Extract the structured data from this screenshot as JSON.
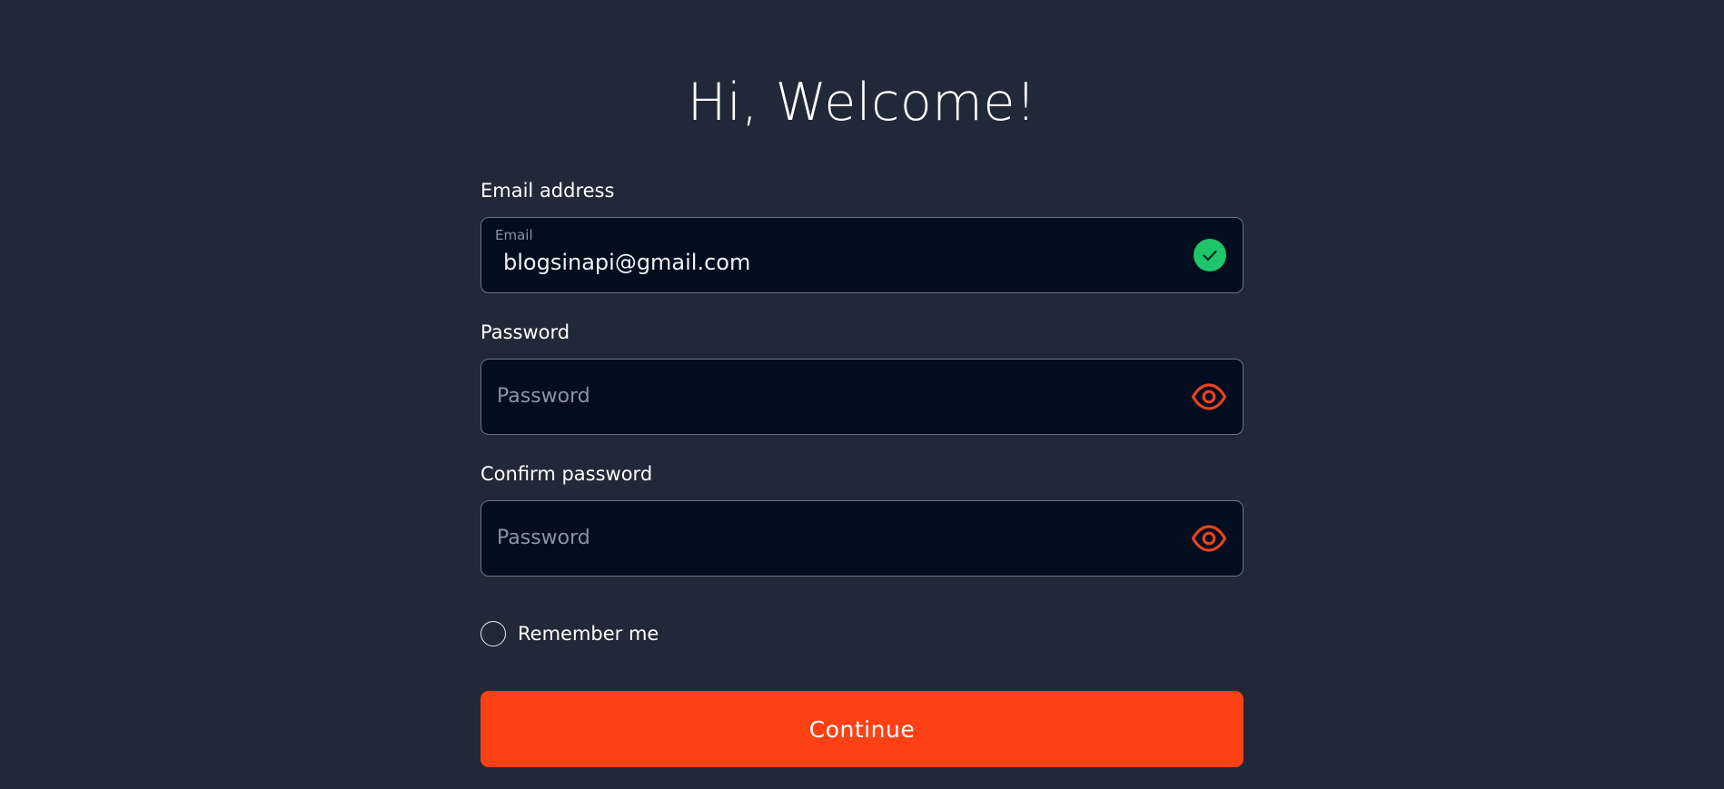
{
  "header": {
    "title": "Hi, Welcome!"
  },
  "form": {
    "email": {
      "label": "Email address",
      "floating_label": "Email",
      "value": "blogsinapi@gmail.com",
      "status_icon": "check-circle-icon",
      "status_color": "#1fc56a"
    },
    "password": {
      "label": "Password",
      "placeholder": "Password",
      "toggle_icon": "eye-icon"
    },
    "confirm_password": {
      "label": "Confirm password",
      "placeholder": "Password",
      "toggle_icon": "eye-icon"
    },
    "remember": {
      "label": "Remember me",
      "checked": false
    },
    "submit": {
      "label": "Continue"
    }
  },
  "colors": {
    "background": "#212938",
    "input_background": "#020d1e",
    "accent": "#fd4114",
    "icon_accent": "#e8431d",
    "success": "#1fc56a"
  }
}
